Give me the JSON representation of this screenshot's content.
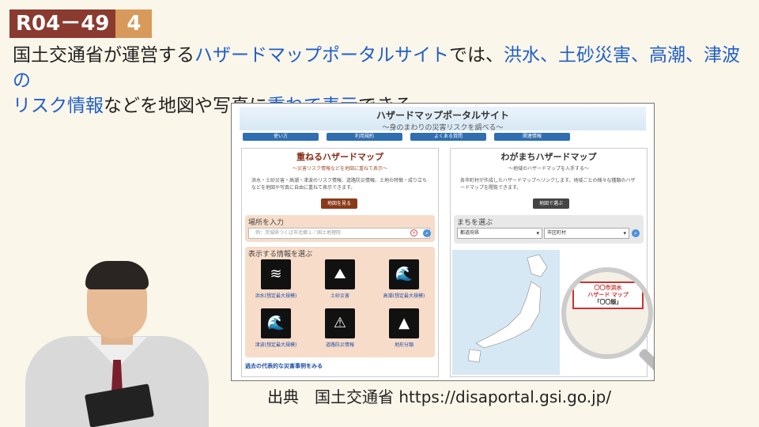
{
  "badge": {
    "code": "R04－49",
    "num": "4"
  },
  "caption": {
    "p1": "国土交通省が運営する",
    "h1": "ハザードマップポータルサイト",
    "p2": "では、",
    "h2": "洪水、土砂災害、高潮、津波の",
    "h3": "リスク情報",
    "p3": "などを地図や写真に",
    "h4": "重ねて表示",
    "p4": "できる。"
  },
  "site": {
    "title": "ハザードマップポータルサイト",
    "subtitle": "～身のまわりの災害リスクを調べる～",
    "nav": [
      "使い方",
      "利用規約",
      "よくある質問",
      "関連情報"
    ],
    "left": {
      "title": "重ねるハザードマップ",
      "subtitle": "～災害リスク情報などを地図に重ねて表示～",
      "body": "洪水・土砂災害・高潮・津波のリスク情報、道路防災情報、土地の特徴・成り立ちなどを地図や写真に自由に重ねて表示できます。",
      "button": "地図を見る",
      "place_label": "場所を入力",
      "place_placeholder": "例：茨城県つくば市北郷１／国土地理院",
      "info_label": "表示する情報を選ぶ",
      "icons": [
        {
          "label": "洪水(想定最大規模)",
          "icon": "flood-icon"
        },
        {
          "label": "土砂災害",
          "icon": "landslide-icon"
        },
        {
          "label": "高潮(想定最大規模)",
          "icon": "storm-surge-icon"
        },
        {
          "label": "津波(想定最大規模)",
          "icon": "tsunami-icon"
        },
        {
          "label": "道路防災情報",
          "icon": "road-disaster-icon"
        },
        {
          "label": "地形分類",
          "icon": "terrain-icon"
        }
      ],
      "link": "過去の代表的な災害事例をみる"
    },
    "right": {
      "title": "わがまちハザードマップ",
      "subtitle": "～地域のハザードマップを入手する～",
      "body": "各市町村が作成したハザードマップへリンクします。地域ごとの様々な種類のハザードマップを閲覧できます。",
      "button": "地図で選ぶ",
      "town_label": "まちを選ぶ",
      "pref_select": "都道府県",
      "city_select": "市区町村",
      "mag_line1": "〇〇市洪水",
      "mag_line2": "ハザード マップ",
      "mag_line3": "「〇〇版」"
    }
  },
  "source": "出典　国土交通省 https://disaportal.gsi.go.jp/"
}
